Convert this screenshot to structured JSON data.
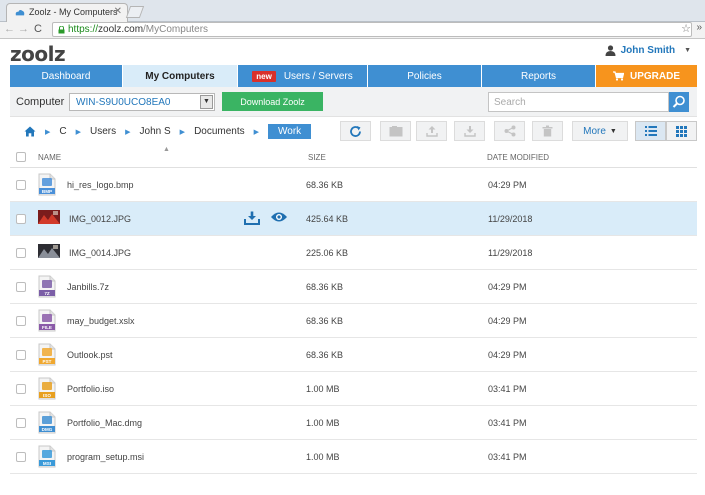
{
  "browser": {
    "tab_title": "Zoolz - My Computers",
    "url_scheme": "https://",
    "url_host": "zoolz.com",
    "url_path": "/MyComputers"
  },
  "app": {
    "logo": "zoolz",
    "user_name": "John Smith"
  },
  "nav": {
    "tabs": [
      {
        "label": "Dashboard"
      },
      {
        "label": "My Computers"
      },
      {
        "label": "Users / Servers",
        "badge": "new"
      },
      {
        "label": "Policies"
      },
      {
        "label": "Reports"
      },
      {
        "label": "UPGRADE"
      }
    ]
  },
  "computer": {
    "label": "Computer",
    "selected": "WIN-S9U0UCO8EA0",
    "download_label": "Download Zoolz",
    "search_placeholder": "Search"
  },
  "breadcrumb": {
    "items": [
      "C",
      "Users",
      "John S",
      "Documents"
    ],
    "current": "Work"
  },
  "toolbar": {
    "more_label": "More"
  },
  "table": {
    "headers": {
      "name": "NAME",
      "size": "SIZE",
      "date": "DATE MODIFIED"
    },
    "rows": [
      {
        "name": "hi_res_logo.bmp",
        "size": "68.36 KB",
        "date": "04:29 PM",
        "icon": "BMP",
        "color": "#4a90d9"
      },
      {
        "name": "IMG_0012.JPG",
        "size": "425.64 KB",
        "date": "11/29/2018",
        "icon": "photo-red",
        "selected": true
      },
      {
        "name": "IMG_0014.JPG",
        "size": "225.06 KB",
        "date": "11/29/2018",
        "icon": "photo-dark"
      },
      {
        "name": "Janbills.7z",
        "size": "68.36 KB",
        "date": "04:29 PM",
        "icon": "7Z",
        "color": "#7b5ea7"
      },
      {
        "name": "may_budget.xslx",
        "size": "68.36 KB",
        "date": "04:29 PM",
        "icon": "FILE",
        "color": "#8a5aa8"
      },
      {
        "name": "Outlook.pst",
        "size": "68.36 KB",
        "date": "04:29 PM",
        "icon": "PST",
        "color": "#f0a830"
      },
      {
        "name": "Portfolio.iso",
        "size": "1.00 MB",
        "date": "03:41 PM",
        "icon": "ISO",
        "color": "#e8a020"
      },
      {
        "name": "Portfolio_Mac.dmg",
        "size": "1.00 MB",
        "date": "03:41 PM",
        "icon": "DMG",
        "color": "#3f8fd2"
      },
      {
        "name": "program_setup.msi",
        "size": "1.00 MB",
        "date": "03:41 PM",
        "icon": "MSI",
        "color": "#3a9ad9"
      }
    ]
  },
  "colors": {
    "primary": "#3f8fd2",
    "active_tab": "#d9ecf9",
    "upgrade": "#f7941d",
    "download": "#3ab463",
    "new_badge": "#d9302a"
  }
}
